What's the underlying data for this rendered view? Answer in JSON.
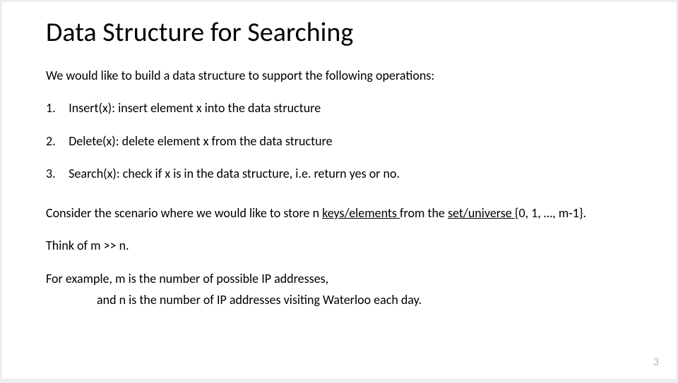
{
  "title": "Data Structure for Searching",
  "intro": "We would like to build a data structure to support the following operations:",
  "ops": [
    {
      "n": "1.",
      "text": "Insert(x): insert element x into the data structure"
    },
    {
      "n": "2.",
      "text": "Delete(x): delete element x from the data structure"
    },
    {
      "n": "3.",
      "text": "Search(x): check if x is in the data structure, i.e. return yes or no."
    }
  ],
  "scenario": {
    "pre": "Consider the scenario where we would like to store n ",
    "u1": "keys/elements ",
    "mid": "from the ",
    "u2": "set/universe ",
    "post": "{0, 1, …, m-1}."
  },
  "think": "Think of m >> n.",
  "example_line1": "For example, m is the number of possible IP addresses,",
  "example_line2": "and n is the number of IP addresses visiting Waterloo each day.",
  "page": "3"
}
